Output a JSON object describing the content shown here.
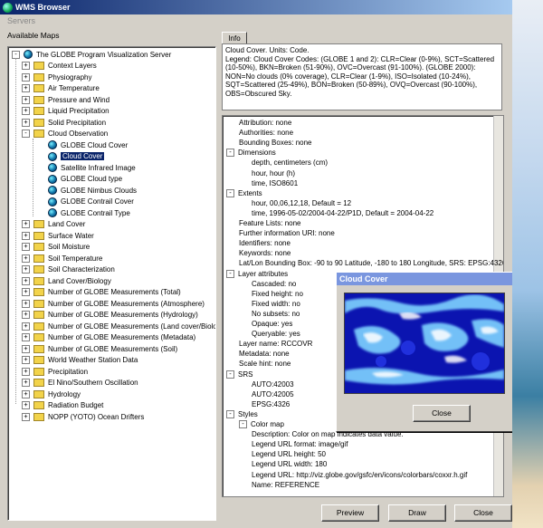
{
  "window": {
    "title": "WMS Browser"
  },
  "menubar": {
    "items": [
      "Servers"
    ]
  },
  "left": {
    "label": "Available Maps"
  },
  "tree": {
    "root": "The GLOBE Program Visualization Server",
    "items": [
      {
        "label": "Context Layers",
        "kind": "folder",
        "depth": 1
      },
      {
        "label": "Physiography",
        "kind": "folder",
        "depth": 1
      },
      {
        "label": "Air Temperature",
        "kind": "folder",
        "depth": 1
      },
      {
        "label": "Pressure and Wind",
        "kind": "folder",
        "depth": 1
      },
      {
        "label": "Liquid Precipitation",
        "kind": "folder",
        "depth": 1
      },
      {
        "label": "Solid Precipitation",
        "kind": "folder",
        "depth": 1
      },
      {
        "label": "Cloud Observation",
        "kind": "folder-open",
        "depth": 1
      },
      {
        "label": "GLOBE Cloud Cover",
        "kind": "layer",
        "depth": 2
      },
      {
        "label": "Cloud Cover",
        "kind": "layer",
        "depth": 2,
        "selected": true
      },
      {
        "label": "Satellite Infrared Image",
        "kind": "layer",
        "depth": 2
      },
      {
        "label": "GLOBE Cloud type",
        "kind": "layer",
        "depth": 2
      },
      {
        "label": "GLOBE Nimbus Clouds",
        "kind": "layer",
        "depth": 2
      },
      {
        "label": "GLOBE Contrail Cover",
        "kind": "layer",
        "depth": 2
      },
      {
        "label": "GLOBE Contrail Type",
        "kind": "layer",
        "depth": 2
      },
      {
        "label": "Land Cover",
        "kind": "folder",
        "depth": 1
      },
      {
        "label": "Surface Water",
        "kind": "folder",
        "depth": 1
      },
      {
        "label": "Soil Moisture",
        "kind": "folder",
        "depth": 1
      },
      {
        "label": "Soil Temperature",
        "kind": "folder",
        "depth": 1
      },
      {
        "label": "Soil Characterization",
        "kind": "folder",
        "depth": 1
      },
      {
        "label": "Land Cover/Biology",
        "kind": "folder",
        "depth": 1
      },
      {
        "label": "Number of GLOBE Measurements (Total)",
        "kind": "folder",
        "depth": 1
      },
      {
        "label": "Number of GLOBE Measurements (Atmosphere)",
        "kind": "folder",
        "depth": 1
      },
      {
        "label": "Number of GLOBE Measurements (Hydrology)",
        "kind": "folder",
        "depth": 1
      },
      {
        "label": "Number of GLOBE Measurements (Land cover/Biology)",
        "kind": "folder",
        "depth": 1
      },
      {
        "label": "Number of GLOBE Measurements (Metadata)",
        "kind": "folder",
        "depth": 1
      },
      {
        "label": "Number of GLOBE Measurements (Soil)",
        "kind": "folder",
        "depth": 1
      },
      {
        "label": "World Weather Station Data",
        "kind": "folder",
        "depth": 1
      },
      {
        "label": "Precipitation",
        "kind": "folder",
        "depth": 1
      },
      {
        "label": "El Nino/Southern Oscillation",
        "kind": "folder",
        "depth": 1
      },
      {
        "label": "Hydrology",
        "kind": "folder",
        "depth": 1
      },
      {
        "label": "Radiation Budget",
        "kind": "folder",
        "depth": 1
      },
      {
        "label": "NOPP (YOTO) Ocean Drifters",
        "kind": "folder",
        "depth": 1
      }
    ]
  },
  "info": {
    "tab": "Info",
    "text": "Cloud Cover. Units: Code.\nLegend: Cloud Cover Codes: (GLOBE 1 and 2): CLR=Clear (0-9%), SCT=Scattered (10-50%), BKN=Broken (51-90%), OVC=Overcast (91-100%). (GLOBE 2000): NON=No clouds (0% coverage), CLR=Clear (1-9%), ISO=Isolated (10-24%), SQT=Scattered (25-49%), BON=Broken (50-89%), OVQ=Overcast (90-100%), OBS=Obscured Sky."
  },
  "properties": [
    {
      "text": "Attribution: none",
      "depth": 1,
      "exp": ""
    },
    {
      "text": "Authorities: none",
      "depth": 1,
      "exp": ""
    },
    {
      "text": "Bounding Boxes: none",
      "depth": 1,
      "exp": ""
    },
    {
      "text": "Dimensions",
      "depth": 0,
      "exp": "-"
    },
    {
      "text": "depth, centimeters (cm)",
      "depth": 2,
      "exp": ""
    },
    {
      "text": "hour, hour (h)",
      "depth": 2,
      "exp": ""
    },
    {
      "text": "time, ISO8601",
      "depth": 2,
      "exp": ""
    },
    {
      "text": "Extents",
      "depth": 0,
      "exp": "-"
    },
    {
      "text": "hour, 00,06,12,18, Default = 12",
      "depth": 2,
      "exp": ""
    },
    {
      "text": "time, 1996-05-02/2004-04-22/P1D, Default = 2004-04-22",
      "depth": 2,
      "exp": ""
    },
    {
      "text": "Feature Lists: none",
      "depth": 1,
      "exp": ""
    },
    {
      "text": "Further information URI: none",
      "depth": 1,
      "exp": ""
    },
    {
      "text": "Identifiers: none",
      "depth": 1,
      "exp": ""
    },
    {
      "text": "Keywords: none",
      "depth": 1,
      "exp": ""
    },
    {
      "text": "Lat/Lon Bounding Box: -90 to 90 Latitude, -180 to 180 Longitude, SRS: EPSG:4326",
      "depth": 1,
      "exp": ""
    },
    {
      "text": "Layer attributes",
      "depth": 0,
      "exp": "-"
    },
    {
      "text": "Cascaded: no",
      "depth": 2,
      "exp": ""
    },
    {
      "text": "Fixed height: no",
      "depth": 2,
      "exp": ""
    },
    {
      "text": "Fixed width: no",
      "depth": 2,
      "exp": ""
    },
    {
      "text": "No subsets: no",
      "depth": 2,
      "exp": ""
    },
    {
      "text": "Opaque: yes",
      "depth": 2,
      "exp": ""
    },
    {
      "text": "Queryable: yes",
      "depth": 2,
      "exp": ""
    },
    {
      "text": "Layer name: RCCOVR",
      "depth": 1,
      "exp": ""
    },
    {
      "text": "Metadata: none",
      "depth": 1,
      "exp": ""
    },
    {
      "text": "Scale hint: none",
      "depth": 1,
      "exp": ""
    },
    {
      "text": "SRS",
      "depth": 0,
      "exp": "-"
    },
    {
      "text": "AUTO:42003",
      "depth": 2,
      "exp": ""
    },
    {
      "text": "AUTO:42005",
      "depth": 2,
      "exp": ""
    },
    {
      "text": "EPSG:4326",
      "depth": 2,
      "exp": ""
    },
    {
      "text": "Styles",
      "depth": 0,
      "exp": "-"
    },
    {
      "text": "Color map",
      "depth": 1,
      "exp": "-"
    },
    {
      "text": "Description: Color on map indicates data value.",
      "depth": 2,
      "exp": ""
    },
    {
      "text": "Legend URL format: image/gif",
      "depth": 2,
      "exp": ""
    },
    {
      "text": "Legend URL height: 50",
      "depth": 2,
      "exp": ""
    },
    {
      "text": "Legend URL width: 180",
      "depth": 2,
      "exp": ""
    },
    {
      "text": "Legend URL: http://viz.globe.gov/gsfc/en/icons/colorbars/coxxr.h.gif",
      "depth": 2,
      "exp": ""
    },
    {
      "text": "Name: REFERENCE",
      "depth": 2,
      "exp": ""
    }
  ],
  "buttons": {
    "preview": "Preview",
    "draw": "Draw",
    "close": "Close"
  },
  "dialog": {
    "title": "Cloud Cover",
    "close": "Close"
  }
}
